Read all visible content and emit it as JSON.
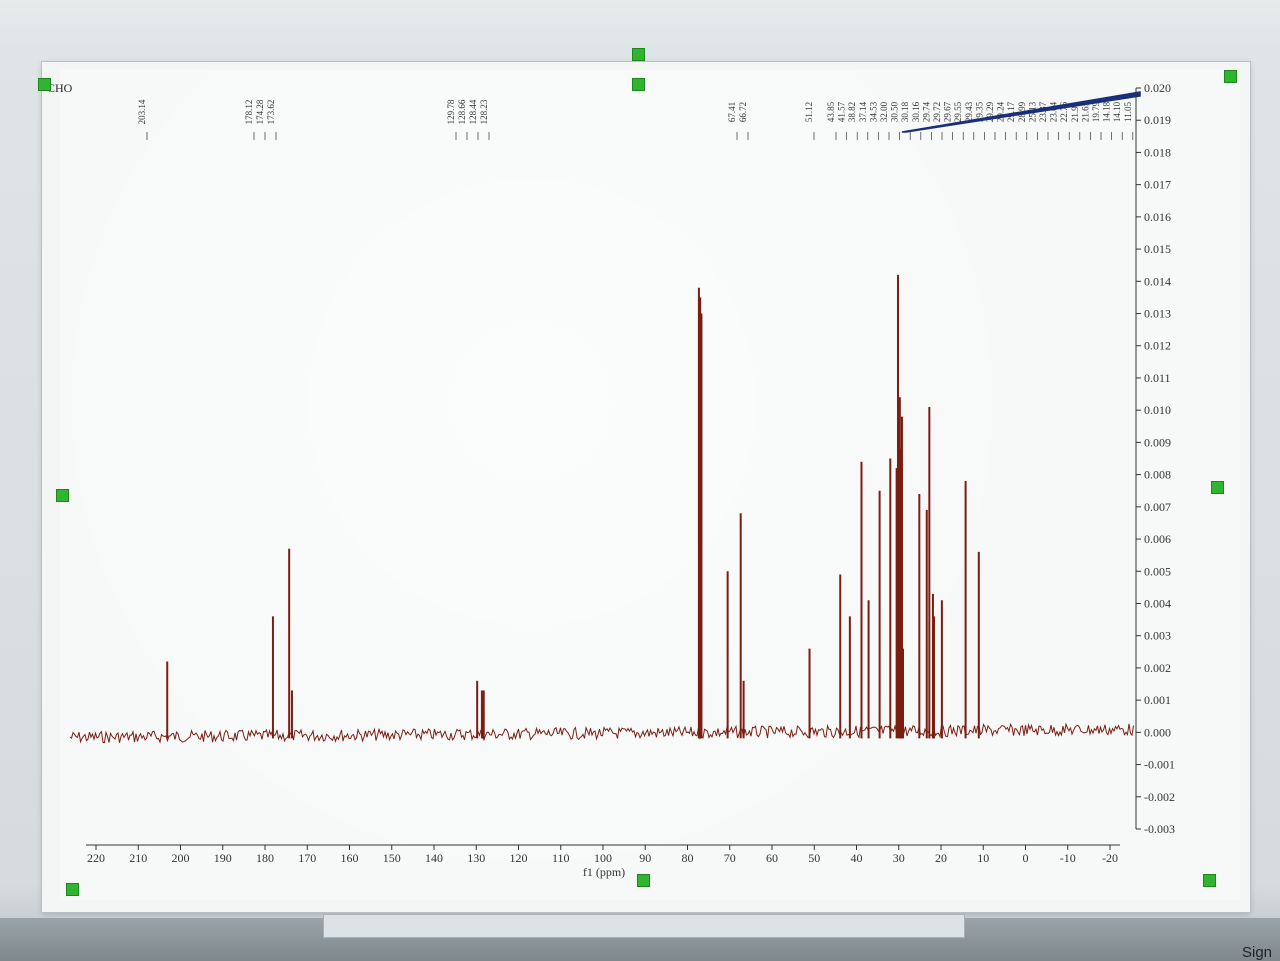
{
  "window": {
    "molecule_label": "CHO",
    "sign_label": "Sign",
    "colors": {
      "spectrum": "#7a1e12",
      "integral": "#1a2f7a",
      "handle": "#2fb52f",
      "axis": "#333333"
    }
  },
  "chart_data": {
    "type": "line",
    "title": "",
    "xlabel": "f1 (ppm)",
    "ylabel": "",
    "xlim": [
      220,
      -20
    ],
    "ylim": [
      -0.003,
      0.02
    ],
    "x_reversed": true,
    "x_ticks": [
      220,
      210,
      200,
      190,
      180,
      170,
      160,
      150,
      140,
      130,
      120,
      110,
      100,
      90,
      80,
      70,
      60,
      50,
      40,
      30,
      20,
      10,
      0,
      -10,
      -20
    ],
    "y_ticks": [
      -0.003,
      -0.002,
      -0.001,
      0.0,
      0.001,
      0.002,
      0.003,
      0.004,
      0.005,
      0.006,
      0.007,
      0.008,
      0.009,
      0.01,
      0.011,
      0.012,
      0.013,
      0.014,
      0.015,
      0.016,
      0.017,
      0.018,
      0.019,
      0.02
    ],
    "y_tick_labels": [
      "-0.003",
      "-0.002",
      "-0.001",
      "0.000",
      "0.001",
      "0.002",
      "0.003",
      "0.004",
      "0.005",
      "0.006",
      "0.007",
      "0.008",
      "0.009",
      "0.010",
      "0.011",
      "0.012",
      "0.013",
      "0.014",
      "0.015",
      "0.016",
      "0.017",
      "0.018",
      "0.019",
      "0.020"
    ],
    "peak_labels": [
      "203.14",
      "178.12",
      "174.28",
      "173.62",
      "129.78",
      "128.66",
      "128.44",
      "128.23",
      "67.41",
      "66.72",
      "51.12",
      "43.85",
      "41.57",
      "38.82",
      "37.14",
      "34.53",
      "32.00",
      "30.50",
      "30.18",
      "30.16",
      "29.74",
      "29.72",
      "29.67",
      "29.55",
      "29.43",
      "29.35",
      "29.29",
      "29.24",
      "29.17",
      "28.99",
      "25.13",
      "23.37",
      "23.04",
      "22.76",
      "21.91",
      "21.65",
      "19.79",
      "14.18",
      "14.10",
      "11.05"
    ],
    "series": [
      {
        "peaks": [
          {
            "x": 203.14,
            "y": 0.0022
          },
          {
            "x": 178.12,
            "y": 0.0036
          },
          {
            "x": 174.28,
            "y": 0.0057
          },
          {
            "x": 173.62,
            "y": 0.0013
          },
          {
            "x": 129.78,
            "y": 0.0016
          },
          {
            "x": 128.66,
            "y": 0.0013
          },
          {
            "x": 128.44,
            "y": 0.0009
          },
          {
            "x": 128.23,
            "y": 0.0013
          },
          {
            "x": 77.3,
            "y": 0.0138
          },
          {
            "x": 77.0,
            "y": 0.0135
          },
          {
            "x": 76.7,
            "y": 0.013
          },
          {
            "x": 67.41,
            "y": 0.0068
          },
          {
            "x": 66.72,
            "y": 0.0016
          },
          {
            "x": 70.5,
            "y": 0.005
          },
          {
            "x": 51.12,
            "y": 0.0026
          },
          {
            "x": 43.85,
            "y": 0.0049
          },
          {
            "x": 41.57,
            "y": 0.0036
          },
          {
            "x": 38.82,
            "y": 0.0084
          },
          {
            "x": 37.14,
            "y": 0.0041
          },
          {
            "x": 34.53,
            "y": 0.0075
          },
          {
            "x": 32.0,
            "y": 0.0085
          },
          {
            "x": 30.5,
            "y": 0.0082
          },
          {
            "x": 30.18,
            "y": 0.0142
          },
          {
            "x": 29.74,
            "y": 0.0104
          },
          {
            "x": 29.67,
            "y": 0.0088
          },
          {
            "x": 29.43,
            "y": 0.0073
          },
          {
            "x": 29.24,
            "y": 0.0098
          },
          {
            "x": 28.99,
            "y": 0.0026
          },
          {
            "x": 25.13,
            "y": 0.0074
          },
          {
            "x": 23.37,
            "y": 0.0069
          },
          {
            "x": 22.76,
            "y": 0.0101
          },
          {
            "x": 21.91,
            "y": 0.0043
          },
          {
            "x": 21.65,
            "y": 0.0036
          },
          {
            "x": 19.79,
            "y": 0.0041
          },
          {
            "x": 14.18,
            "y": 0.0078
          },
          {
            "x": 11.05,
            "y": 0.0056
          }
        ]
      }
    ],
    "grid": false,
    "legend": "none"
  }
}
